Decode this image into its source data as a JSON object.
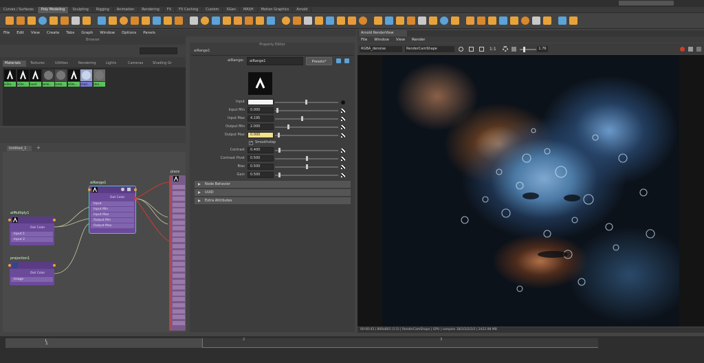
{
  "shelf": {
    "tabs": [
      "Curves / Surfaces",
      "Poly Modeling",
      "Sculpting",
      "Rigging",
      "Animation",
      "Rendering",
      "FX",
      "FX Caching",
      "Custom",
      "XGen",
      "MASH",
      "Motion Graphics",
      "Arnold"
    ],
    "active_tab": "Poly Modeling"
  },
  "menubar": {
    "items": [
      "File",
      "Edit",
      "View",
      "Create",
      "Tabs",
      "Graph",
      "Window",
      "Options",
      "Panels"
    ]
  },
  "browser": {
    "title": "Browser",
    "tabs": [
      "Materials",
      "Textures",
      "Utilities",
      "Rendering",
      "Lights",
      "Cameras",
      "Shading Gr"
    ],
    "swatches": [
      "aiSta...",
      "aiSta...",
      "hwsd",
      "lamb...",
      "lamb...",
      "aiSta...",
      "shad...",
      "stan..."
    ]
  },
  "graph": {
    "tab": "Untitled_1",
    "nodes": {
      "airange": {
        "title": "aiRange1",
        "out": "Out Color",
        "ports": [
          "Input",
          "Input Min",
          "Input Max",
          "Output Min",
          "Output Max"
        ]
      },
      "aimultiply": {
        "title": "aiMultiply1",
        "out": "Out Color",
        "ports": [
          "Input 1",
          "Input 2"
        ]
      },
      "projection": {
        "title": "projection1",
        "out": "Out Color",
        "ports": [
          "Image"
        ]
      },
      "place": {
        "title": "place"
      }
    }
  },
  "property_editor": {
    "title": "Property Editor",
    "node_tab": "aiRange1",
    "node_label": "aiRange:",
    "node_name": "aiRange1",
    "presets": "Presets*",
    "attrs": [
      {
        "label": "Input",
        "value": ""
      },
      {
        "label": "Input Min",
        "value": "0.000"
      },
      {
        "label": "Input Max",
        "value": "4.195"
      },
      {
        "label": "Output Min",
        "value": "2.000"
      },
      {
        "label": "Output Max",
        "value": "0.000"
      }
    ],
    "smoothstep": "Smoothstep",
    "attrs2": [
      {
        "label": "Contrast",
        "value": "0.400"
      },
      {
        "label": "Contrast Pivot",
        "value": "0.500"
      },
      {
        "label": "Bias",
        "value": "0.500"
      },
      {
        "label": "Gain",
        "value": "0.500"
      }
    ],
    "sections": [
      "Node Behavior",
      "UUID",
      "Extra Attributes"
    ]
  },
  "renderview": {
    "title": "Arnold RenderView",
    "menu": [
      "File",
      "Window",
      "View",
      "Render"
    ],
    "aov": "RGBA_denoise",
    "camera": "RenderCamShape",
    "ratio": "1:1",
    "exposure": "1.76",
    "status": "00:00:43 | 800x801 (1:1) | RenderCamShape | GPU | samples 18/2/2/2/2/2 | 2422.98 MB"
  },
  "timeline": {
    "ticks": [
      "1",
      "2",
      "3"
    ]
  },
  "colors": {
    "accent": "#5ba3d8",
    "node": "#6b4a9a",
    "selected": "#4ec4c4"
  }
}
